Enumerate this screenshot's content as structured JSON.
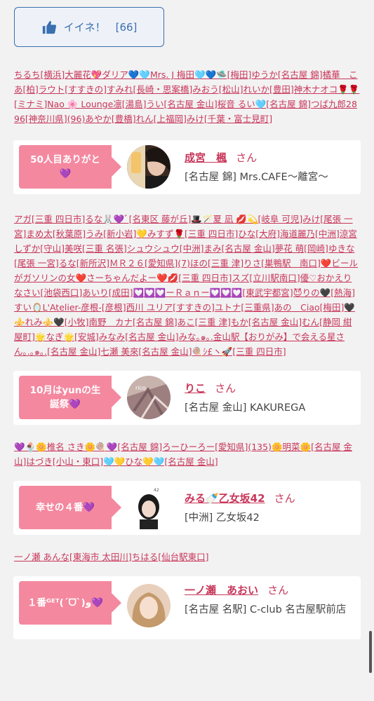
{
  "like": {
    "label": "イイネ！",
    "count": "[66]",
    "icon": "thumbs-up-icon"
  },
  "names1": "ちるち[横浜]大麗花💖ダリア💙🩵Mrs. J 梅田🩵💙🛸[梅田]ゆうか[名古屋 錦]橘華　こあ[柏]ラウト[すすきの]すみれ[長崎・思案橋]みおう[松山]れいか[豊田]神木ナオコ🌹🌹[ミナミ]Nao 🌸 Lounge凛[湯島]うい[名古屋 金山]桜音 るい🩵[名古屋 錦]つば九郎2896[神奈川県](96)あやか[豊橋]れん[上福岡]みけ[千葉・富士見町]",
  "card1": {
    "badge": "50人目ありがと💜",
    "name": "成宮　楓",
    "san": "さん",
    "shop": "[名古屋 錦] Mrs.CAFE〜離宮〜"
  },
  "names2": "アガ[三重 四日市]るな🐰💜ﾞ[名東区 藤が丘]🎩🪄夏 凪 💋💫[岐阜 可児]みけ[尾張 一宮]まめ太[秋葉原]うみ[新小岩]💛みすず🌹[三重 四日市]ひな[大府]海道麗乃[中洲]涼宮 しずか[守山]美咲[三重 名張]シュウシュウ[中洲]まみ[名古屋 金山]夢花 萌[岡崎]ゆきな[尾張 一宮]るな[新所沢]ＭＲ２６[愛知県](7)ほの[三重 津]りさ[巣鴨駅　南口]❤️ビールがガソリンの女❤️さーちゃんだよー❤️💋[三重 四日市]スズ[立川駅南口]優♡おかえりなさい[池袋西口]あいり[成田]💟💟💟ーＲａｎー💟💟💟[東武宇都宮]😈りの🖤[熱海]すい🪞L'Atelier-彦根-[彦根]西川 ユリア[すすきの]ユトナ[三重県]あの　Ciao[梅田]🖤⚜️れみ⚜️🖤[小牧]南野　カナ[名古屋 錦]あこ[三重 津]もか[名古屋 金山]むん[静岡 紺屋町]🌟なぎ🌟[安城]みなみ[名古屋 金山]みな｡๑｡.金山駅【おりがみ】で会える星さん｡.｡๑｡.[名古屋 金山]七瀬 美來[名古屋 金山]🍭ｼ£ヽ🚀[三重 四日市]",
  "card2": {
    "badge": "10月はyunの生誕祭💜",
    "name": "りこ",
    "san": "さん",
    "shop": "[名古屋 金山] KAKUREGA"
  },
  "names3": "💜🍨🌼椎名 さき🌼🍭💜[名古屋 錦]ろーひーろー[愛知県](135)🌼明菜🌼[名古屋 金山]はづき[小山・東口]🩵💛ひな💛🩵[名古屋 金山]",
  "card3": {
    "badge": "幸せの４番💜",
    "name": "みる🍼乙女坂42",
    "san": "さん",
    "shop": "[中洲] 乙女坂42"
  },
  "names4": "一ノ瀬 あんな[東海市 太田川]ちはる[仙台駅東口]",
  "card4": {
    "badge": "１番ᴳᴱᵀ(ˊᗜˋ)و💜",
    "name": "一ノ瀬　あおい",
    "san": "さん",
    "shop": "[名古屋 名駅] C-club 名古屋駅前店"
  },
  "colors": {
    "accent": "#c8375a",
    "badge": "#f4889f",
    "like": "#3a6fb0"
  }
}
